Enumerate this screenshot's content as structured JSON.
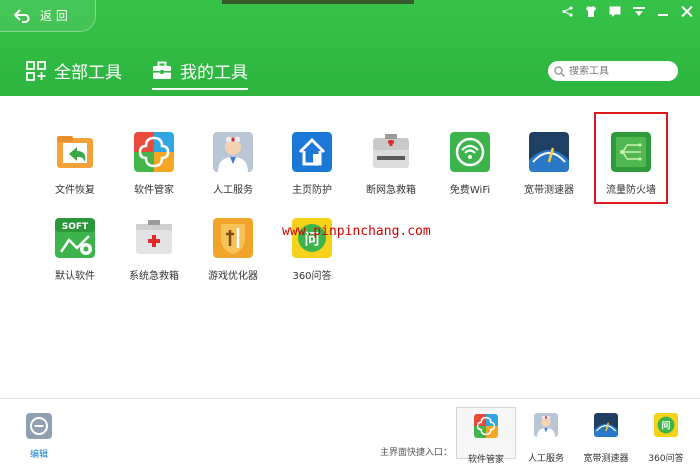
{
  "header": {
    "back_label": "返 回",
    "tab_all": "全部工具",
    "tab_mine": "我的工具",
    "search_placeholder": "搜索工具"
  },
  "tools": [
    {
      "label": "文件恢复",
      "icon": "file-restore-icon"
    },
    {
      "label": "软件管家",
      "icon": "software-manager-icon"
    },
    {
      "label": "人工服务",
      "icon": "human-service-icon"
    },
    {
      "label": "主页防护",
      "icon": "homepage-protect-icon"
    },
    {
      "label": "断网急救箱",
      "icon": "network-firstaid-icon"
    },
    {
      "label": "免费WiFi",
      "icon": "wifi-icon"
    },
    {
      "label": "宽带测速器",
      "icon": "speedtest-icon"
    },
    {
      "label": "流量防火墙",
      "icon": "traffic-firewall-icon"
    },
    {
      "label": "默认软件",
      "icon": "default-software-icon"
    },
    {
      "label": "系统急救箱",
      "icon": "system-firstaid-icon"
    },
    {
      "label": "游戏优化器",
      "icon": "game-optimizer-icon"
    },
    {
      "label": "360问答",
      "icon": "qa-icon"
    }
  ],
  "watermark": "www.pinpinchang.com",
  "footer": {
    "edit_label": "编辑",
    "quick_label": "主界面快捷入口：",
    "quick": [
      {
        "label": "软件管家"
      },
      {
        "label": "人工服务"
      },
      {
        "label": "宽带测速器"
      },
      {
        "label": "360问答"
      }
    ]
  },
  "colors": {
    "header_green": "#2db53f",
    "highlight_red": "#e0191e",
    "link_blue": "#1a7fd4"
  }
}
